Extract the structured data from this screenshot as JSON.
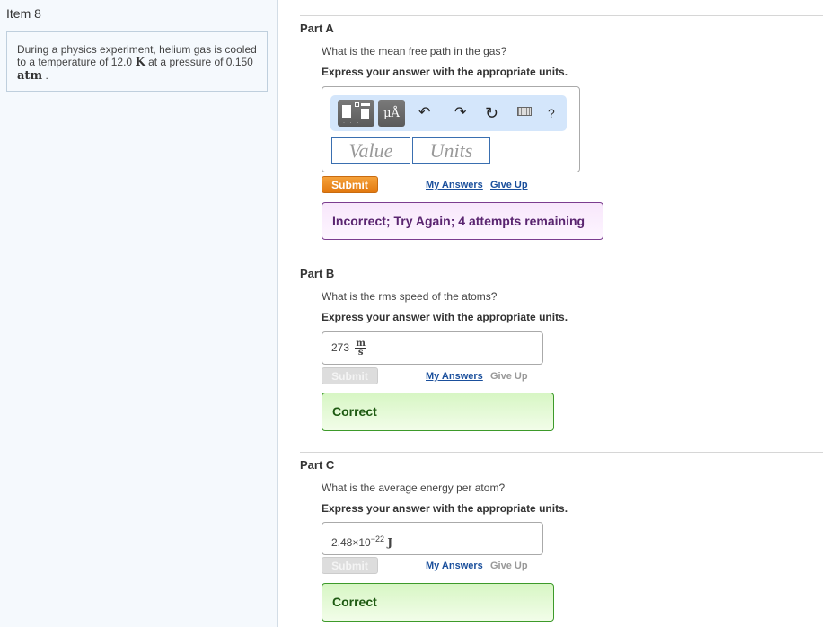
{
  "left_panel": {
    "item_title": "Item 8",
    "problem": {
      "text_1": "During a physics experiment, helium gas is cooled to a temperature of 12.0",
      "unit_1": "K",
      "text_2": "at a pressure of 0.150",
      "unit_2": "atm",
      "text_3": "."
    }
  },
  "parts": {
    "a": {
      "title": "Part A",
      "question": "What is the mean free path in the gas?",
      "instruction": "Express your answer with the appropriate units.",
      "toolbar": {
        "templates_icon": "templates-icon",
        "units_label": "μÅ",
        "undo_icon": "↶",
        "redo_icon": "↷",
        "reset_icon": "↻",
        "keyboard_icon": "keyboard-icon",
        "help_label": "?"
      },
      "value_placeholder": "Value",
      "units_placeholder": "Units",
      "submit_label": "Submit",
      "my_answers_label": "My Answers",
      "give_up_label": "Give Up",
      "feedback": "Incorrect; Try Again; 4 attempts remaining"
    },
    "b": {
      "title": "Part B",
      "question": "What is the rms speed of the atoms?",
      "instruction": "Express your answer with the appropriate units.",
      "answer_value": "273",
      "answer_unit_num": "m",
      "answer_unit_den": "s",
      "submit_label": "Submit",
      "my_answers_label": "My Answers",
      "give_up_label": "Give Up",
      "feedback": "Correct"
    },
    "c": {
      "title": "Part C",
      "question": "What is the average energy per atom?",
      "instruction": "Express your answer with the appropriate units.",
      "answer_mantissa": "2.48×10",
      "answer_exponent": "−22",
      "answer_unit": "J",
      "submit_label": "Submit",
      "my_answers_label": "My Answers",
      "give_up_label": "Give Up",
      "feedback": "Correct"
    }
  },
  "colors": {
    "submit_active": "#e2790f",
    "incorrect_border": "#7b3d8f",
    "correct_border": "#3d9a2a",
    "link": "#1a4f9c"
  }
}
